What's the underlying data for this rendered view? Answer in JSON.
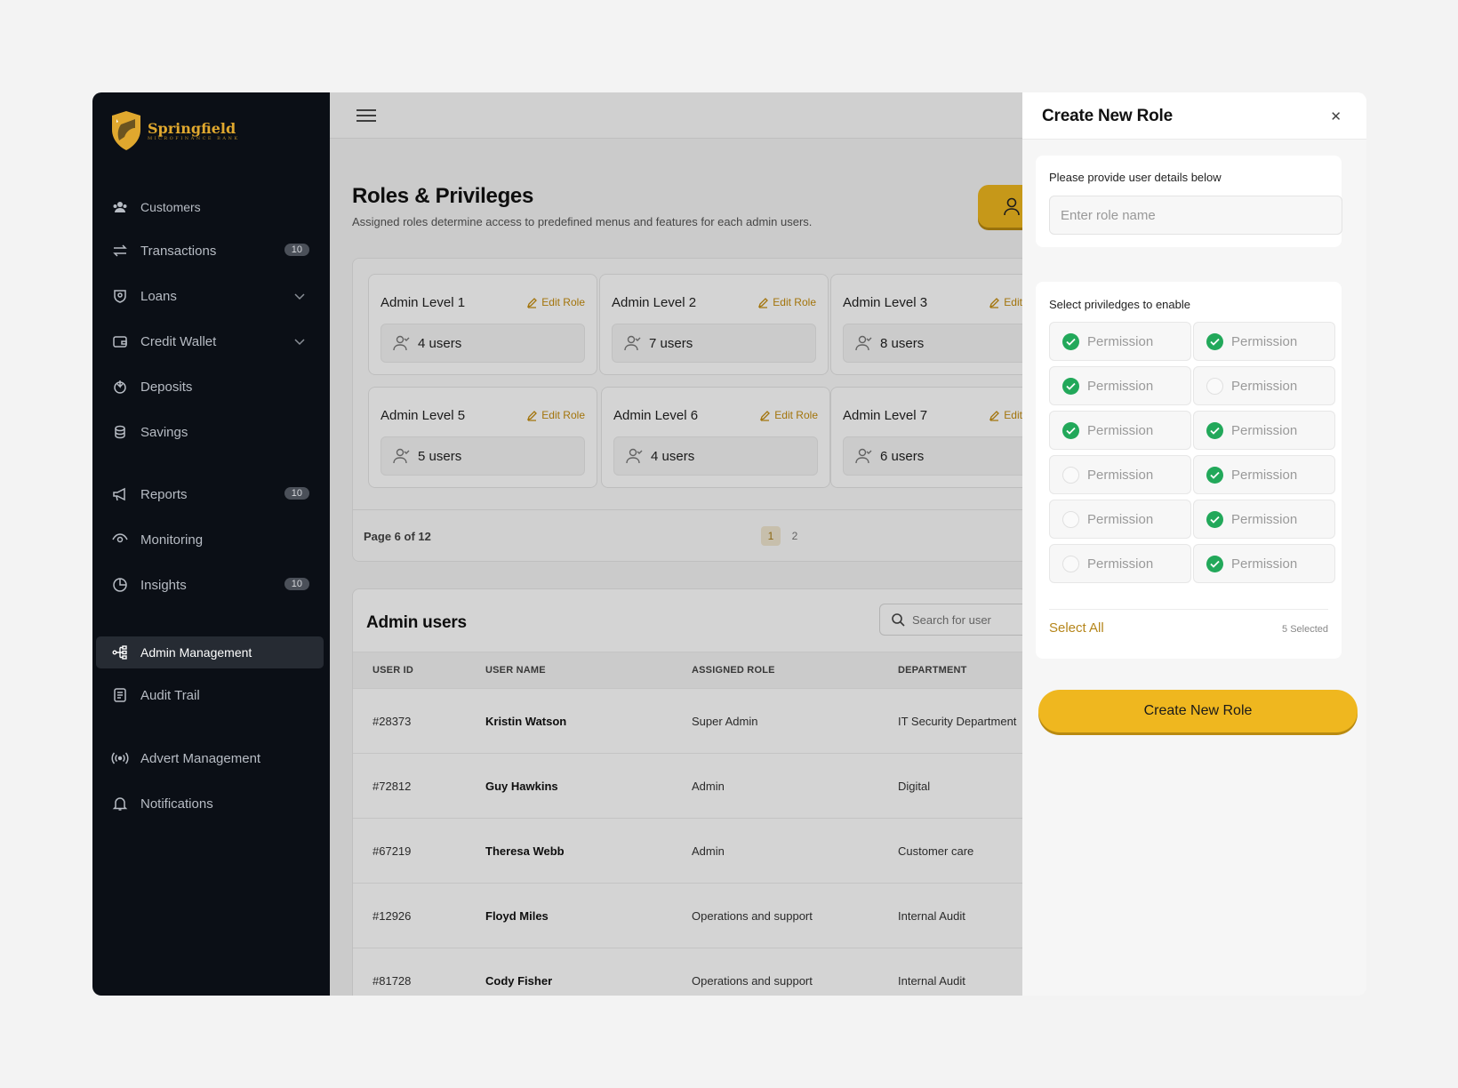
{
  "brand": {
    "name": "Springfield",
    "subtitle": "MICROFINANCE BANK",
    "color": "#e0a82e"
  },
  "sidebar": {
    "items": [
      {
        "label": "Customers",
        "icon": "users-icon"
      },
      {
        "label": "Transactions",
        "icon": "swap-icon",
        "badge": "10"
      },
      {
        "label": "Loans",
        "icon": "shield-coin-icon",
        "expandable": true
      },
      {
        "label": "Credit Wallet",
        "icon": "wallet-icon",
        "expandable": true
      },
      {
        "label": "Deposits",
        "icon": "deposit-icon"
      },
      {
        "label": "Savings",
        "icon": "coins-icon"
      },
      {
        "label": "Reports",
        "icon": "megaphone-icon",
        "badge": "10"
      },
      {
        "label": "Monitoring",
        "icon": "eye-icon"
      },
      {
        "label": "Insights",
        "icon": "pie-chart-icon",
        "badge": "10"
      },
      {
        "label": "Admin Management",
        "icon": "hierarchy-icon",
        "active": true
      },
      {
        "label": "Audit Trail",
        "icon": "document-icon"
      },
      {
        "label": "Advert Management",
        "icon": "broadcast-icon"
      },
      {
        "label": "Notifications",
        "icon": "bell-icon"
      }
    ]
  },
  "page": {
    "title": "Roles & Privileges",
    "subtitle": "Assigned roles determine access to predefined menus and features for each admin users."
  },
  "roles": {
    "edit_label": "Edit Role",
    "cards": [
      {
        "name": "Admin Level 1",
        "users": "4 users"
      },
      {
        "name": "Admin Level 2",
        "users": "7 users"
      },
      {
        "name": "Admin Level 3",
        "users": "8 users"
      },
      {
        "name": "Admin Level 5",
        "users": "5 users"
      },
      {
        "name": "Admin Level 6",
        "users": "4 users"
      },
      {
        "name": "Admin Level 7",
        "users": "6 users"
      }
    ],
    "page_label": "Page 6 of 12",
    "pages": [
      "1",
      "2"
    ]
  },
  "admin_users": {
    "title": "Admin users",
    "search_placeholder": "Search for user",
    "columns": [
      "USER ID",
      "USER NAME",
      "ASSIGNED ROLE",
      "DEPARTMENT"
    ],
    "rows": [
      {
        "id": "#28373",
        "name": "Kristin Watson",
        "role": "Super Admin",
        "department": "IT Security Department"
      },
      {
        "id": "#72812",
        "name": "Guy Hawkins",
        "role": "Admin",
        "department": "Digital"
      },
      {
        "id": "#67219",
        "name": "Theresa Webb",
        "role": "Admin",
        "department": "Customer care"
      },
      {
        "id": "#12926",
        "name": "Floyd Miles",
        "role": "Operations and support",
        "department": "Internal Audit"
      },
      {
        "id": "#81728",
        "name": "Cody Fisher",
        "role": "Operations and support",
        "department": "Internal Audit"
      }
    ]
  },
  "drawer": {
    "title": "Create New Role",
    "details_label": "Please provide user details below",
    "role_placeholder": "Enter role name",
    "privileges_label": "Select priviledges to enable",
    "permissions": [
      {
        "label": "Permission",
        "checked": true
      },
      {
        "label": "Permission",
        "checked": true
      },
      {
        "label": "Permission",
        "checked": true
      },
      {
        "label": "Permission",
        "checked": false
      },
      {
        "label": "Permission",
        "checked": true
      },
      {
        "label": "Permission",
        "checked": true
      },
      {
        "label": "Permission",
        "checked": false
      },
      {
        "label": "Permission",
        "checked": true
      },
      {
        "label": "Permission",
        "checked": false
      },
      {
        "label": "Permission",
        "checked": true
      },
      {
        "label": "Permission",
        "checked": false
      },
      {
        "label": "Permission",
        "checked": true
      }
    ],
    "select_all_label": "Select All",
    "selected_count": "5 Selected",
    "submit_label": "Create New Role"
  },
  "colors": {
    "accent": "#efb71f",
    "success": "#22a85a",
    "sidebar": "#0b0f16"
  }
}
